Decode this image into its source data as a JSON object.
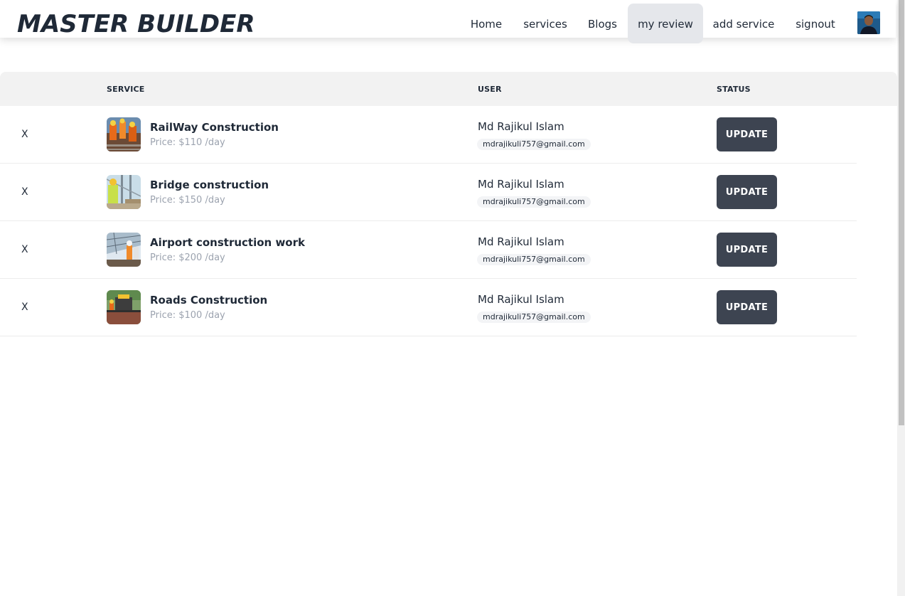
{
  "brand": "MASTER BUILDER",
  "nav": {
    "items": [
      "Home",
      "services",
      "Blogs",
      "my review",
      "add service",
      "signout"
    ],
    "active": "my review"
  },
  "table": {
    "headers": [
      "",
      "SERVICE",
      "USER",
      "STATUS"
    ],
    "rows": [
      {
        "remove": "X",
        "service_name": "RailWay Construction",
        "price": "Price: $110 /day",
        "user_name": "Md Rajikul Islam",
        "email": "mdrajikuli757@gmail.com",
        "action": "UPDATE",
        "thumb_icon": "railway-photo"
      },
      {
        "remove": "X",
        "service_name": "Bridge construction",
        "price": "Price: $150 /day",
        "user_name": "Md Rajikul Islam",
        "email": "mdrajikuli757@gmail.com",
        "action": "UPDATE",
        "thumb_icon": "bridge-photo"
      },
      {
        "remove": "X",
        "service_name": "Airport construction work",
        "price": "Price: $200 /day",
        "user_name": "Md Rajikul Islam",
        "email": "mdrajikuli757@gmail.com",
        "action": "UPDATE",
        "thumb_icon": "airport-photo"
      },
      {
        "remove": "X",
        "service_name": "Roads Construction",
        "price": "Price: $100 /day",
        "user_name": "Md Rajikul Islam",
        "email": "mdrajikuli757@gmail.com",
        "action": "UPDATE",
        "thumb_icon": "roads-photo"
      }
    ]
  },
  "colors": {
    "button_bg": "#3d4451",
    "header_bg": "#f2f2f2",
    "active_nav_bg": "#e5e7eb",
    "price_text": "#9ca3af"
  }
}
